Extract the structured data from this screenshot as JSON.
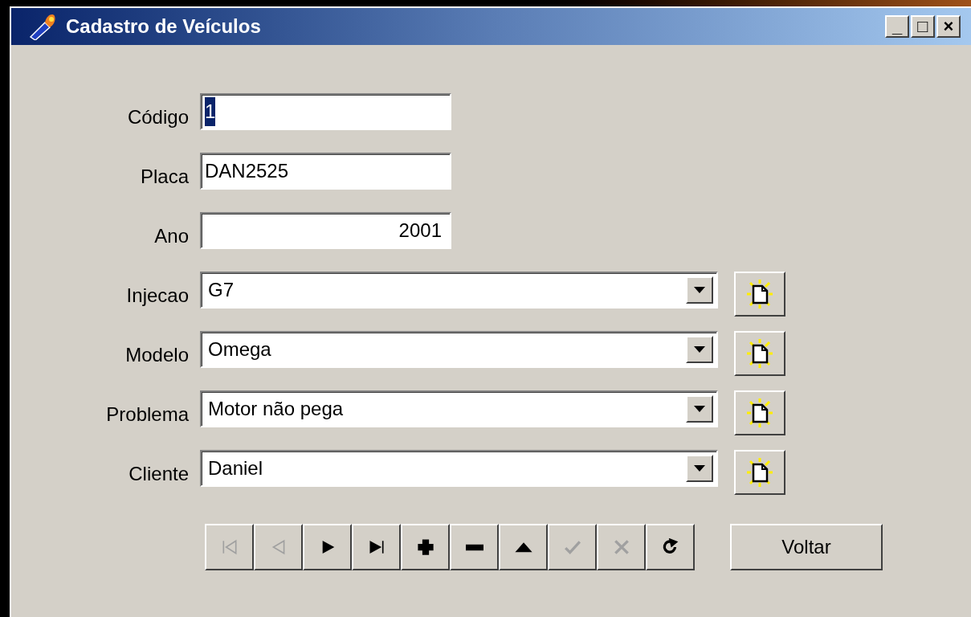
{
  "window": {
    "title": "Cadastro de Veículos",
    "controls": [
      "_",
      "□",
      "×"
    ]
  },
  "fields": [
    {
      "kind": "edit",
      "label": "Código",
      "value": "1",
      "text_selected": true
    },
    {
      "kind": "edit",
      "label": "Placa",
      "value": "DAN2525",
      "text_selected": false
    },
    {
      "kind": "number",
      "label": "Ano",
      "value": "2001",
      "text_selected": false
    },
    {
      "kind": "combo",
      "label": "Injecao",
      "value": "G7"
    },
    {
      "kind": "combo",
      "label": "Modelo",
      "value": "Omega"
    },
    {
      "kind": "combo",
      "label": "Problema",
      "value": "Motor não pega"
    },
    {
      "kind": "combo",
      "label": "Cliente",
      "value": "Daniel"
    }
  ],
  "navigator": [
    {
      "kind": "first",
      "disabled": true
    },
    {
      "kind": "prior",
      "disabled": true
    },
    {
      "kind": "next",
      "disabled": false
    },
    {
      "kind": "last",
      "disabled": false
    },
    {
      "kind": "insert",
      "disabled": false
    },
    {
      "kind": "delete",
      "disabled": false
    },
    {
      "kind": "edit",
      "disabled": false
    },
    {
      "kind": "post",
      "disabled": true
    },
    {
      "kind": "cancel",
      "disabled": true
    },
    {
      "kind": "refresh",
      "disabled": false
    }
  ],
  "back_button": "Voltar"
}
